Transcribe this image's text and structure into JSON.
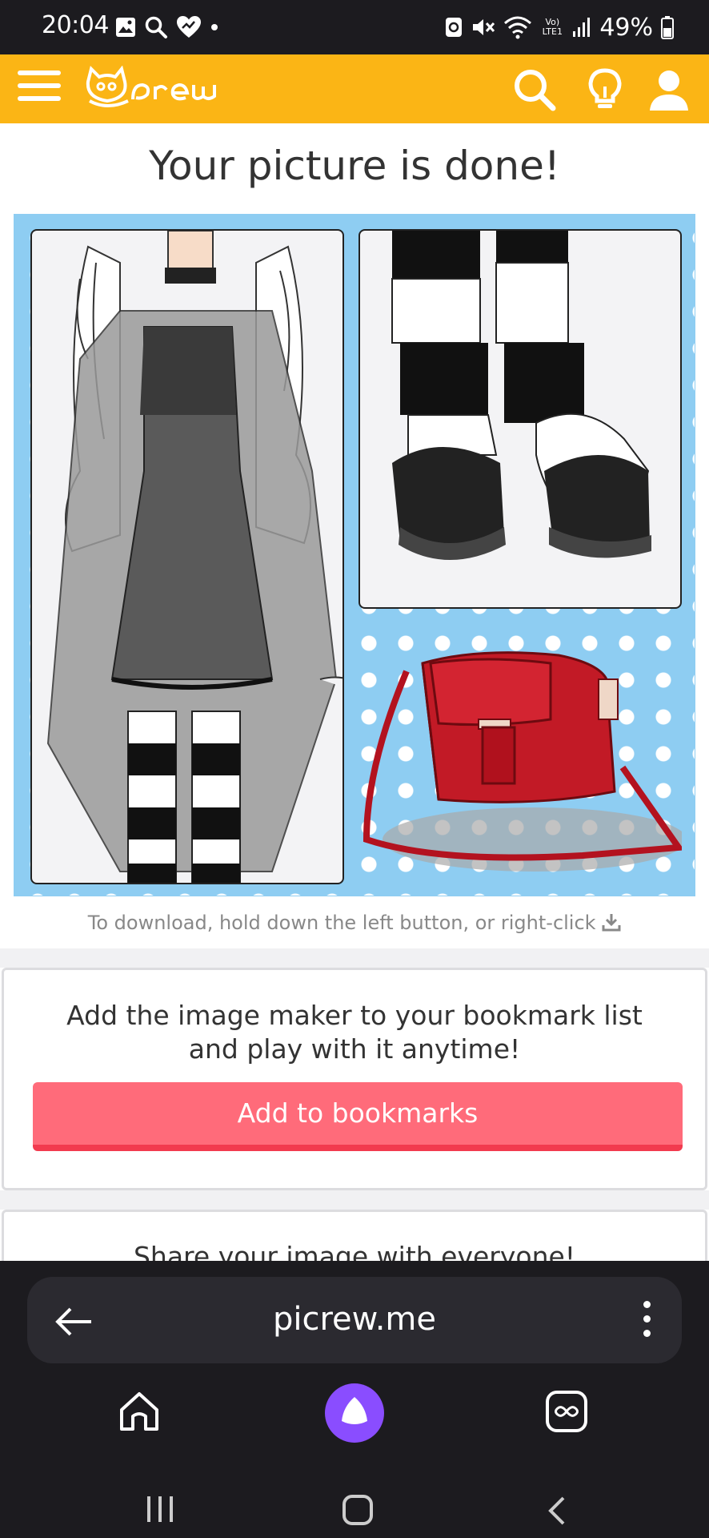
{
  "status_bar": {
    "time": "20:04",
    "battery": "49%",
    "left_icons": [
      "image-icon",
      "search-icon",
      "heart-icon",
      "dot-icon"
    ],
    "right_icons": [
      "sync-icon",
      "mute-icon",
      "wifi-icon",
      "volte-icon",
      "signal-icon",
      "battery-icon"
    ],
    "network_label": "Vo) LTE1"
  },
  "header": {
    "logo_text": "Picrew",
    "icons": [
      "menu-icon",
      "search-icon",
      "lightbulb-icon",
      "user-icon"
    ],
    "brand_color": "#fbb515"
  },
  "main": {
    "title": "Your picture is done!",
    "download_hint": "To download, hold down the left button, or right-click",
    "download_icon": "download-icon"
  },
  "bookmark_card": {
    "text_line1": "Add the image maker to your bookmark list",
    "text_line2": "and play with it anytime!",
    "button_label": "Add to bookmarks",
    "button_color": "#ff6b7a"
  },
  "share_card": {
    "text": "Share your image with everyone!"
  },
  "browser": {
    "url": "picrew.me",
    "nav_icons": [
      "back-arrow-icon",
      "more-icon",
      "home-icon",
      "assistant-icon",
      "tabs-icon"
    ]
  },
  "system_nav": {
    "icons": [
      "recents-icon",
      "home-icon",
      "back-icon"
    ]
  }
}
